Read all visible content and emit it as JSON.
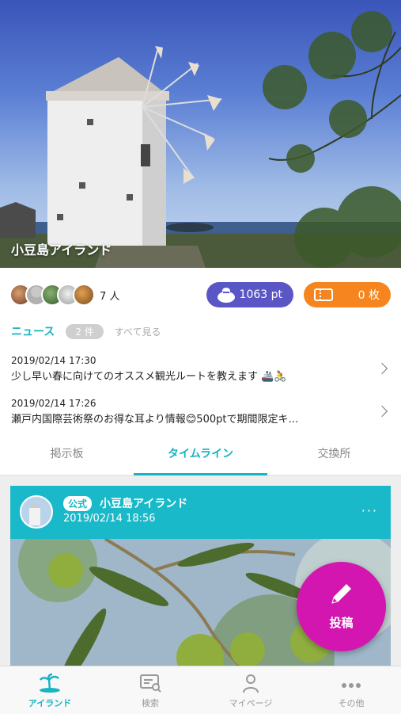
{
  "hero": {
    "title": "小豆島アイランド"
  },
  "members": {
    "count_label": "7 人"
  },
  "points": {
    "value": "1063 pt",
    "icon": "money-bag-icon"
  },
  "tickets": {
    "value": "0 枚",
    "icon": "ticket-icon"
  },
  "news": {
    "title": "ニュース",
    "count": "2 件",
    "see_all": "すべて見る",
    "items": [
      {
        "date": "2019/02/14 17:30",
        "text": "少し早い春に向けてのオススメ観光ルートを教えます 🚢🚴"
      },
      {
        "date": "2019/02/14 17:26",
        "text": "瀬戸内国際芸術祭のお得な耳より情報😊500ptで期間限定キ…"
      }
    ]
  },
  "tabs": [
    {
      "label": "掲示板"
    },
    {
      "label": "タイムライン"
    },
    {
      "label": "交換所"
    }
  ],
  "post": {
    "official_badge": "公式",
    "author": "小豆島アイランド",
    "date": "2019/02/14 18:56",
    "more": "···"
  },
  "fab": {
    "label": "投稿",
    "icon": "pencil-icon"
  },
  "bottom_nav": [
    {
      "label": "アイランド",
      "icon": "island-icon"
    },
    {
      "label": "検索",
      "icon": "search-icon"
    },
    {
      "label": "マイページ",
      "icon": "person-icon"
    },
    {
      "label": "その他",
      "icon": "more-dots-icon"
    }
  ],
  "colors": {
    "accent": "#16b4c4",
    "points": "#5a56c6",
    "tickets": "#f6851f",
    "fab": "#d416b0"
  }
}
